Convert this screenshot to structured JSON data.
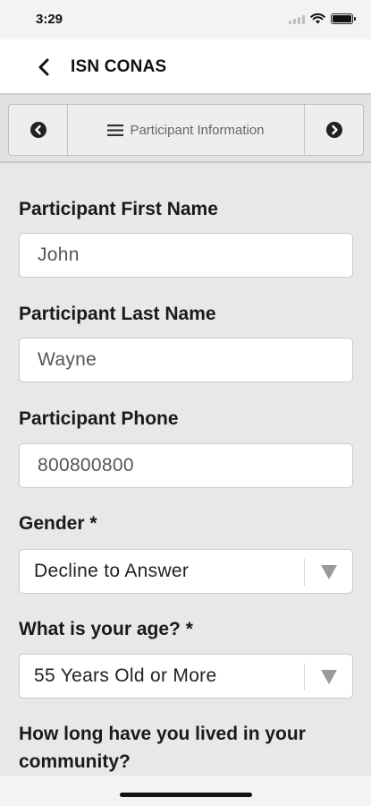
{
  "status_bar": {
    "time": "3:29"
  },
  "nav": {
    "title": "ISN CONAS",
    "back_icon": "chevron-left-icon"
  },
  "section": {
    "title": "Participant Information",
    "prev_icon": "circle-chevron-left-icon",
    "next_icon": "circle-chevron-right-icon",
    "menu_icon": "hamburger-icon"
  },
  "form": {
    "first_name": {
      "label": "Participant First Name",
      "value": "John"
    },
    "last_name": {
      "label": "Participant Last Name",
      "value": "Wayne"
    },
    "phone": {
      "label": "Participant Phone",
      "value": "800800800"
    },
    "gender": {
      "label": "Gender *",
      "value": "Decline to Answer"
    },
    "age": {
      "label": "What is your age? *",
      "value": "55 Years Old or More"
    },
    "community": {
      "label": "How long have you lived in your community?"
    }
  }
}
